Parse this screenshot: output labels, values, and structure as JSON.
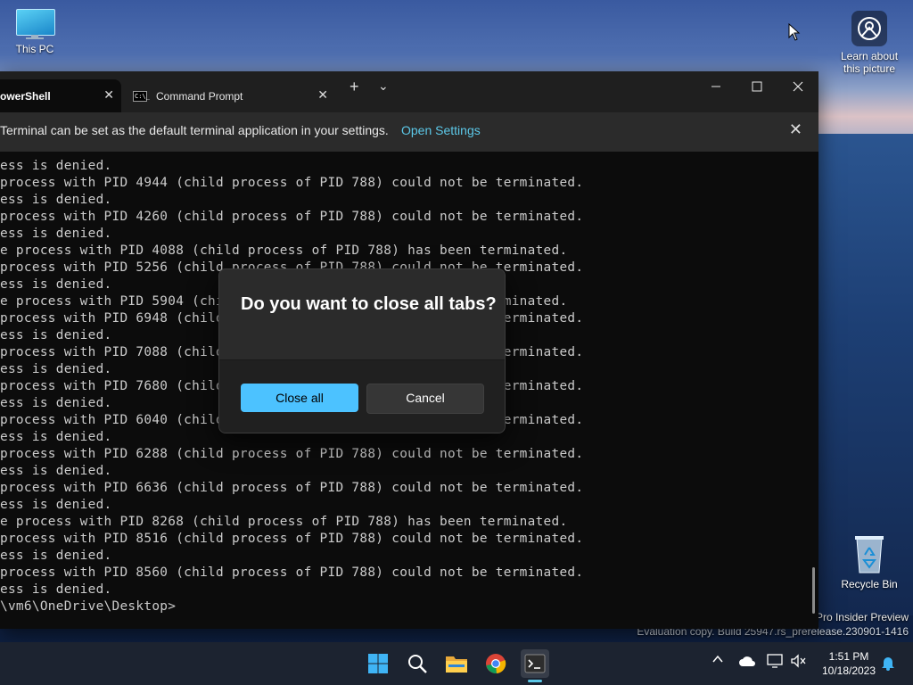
{
  "desktop": {
    "this_pc_label": "This PC",
    "learn_label_1": "Learn about",
    "learn_label_2": "this picture",
    "recycle_bin_label": "Recycle Bin",
    "watermark_line1": "Pro Insider Preview",
    "watermark_line2": "Evaluation copy. Build 25947.rs_prerelease.230901-1416"
  },
  "terminal": {
    "tabs": [
      {
        "label": "owerShell",
        "icon": "powershell-icon"
      },
      {
        "label": "Command Prompt",
        "icon": "cmd-icon"
      }
    ],
    "cmd_icon_text": "C:\\_",
    "new_tab_glyph": "+",
    "dropdown_glyph": "⌄",
    "infobar": {
      "message": "Terminal can be set as the default terminal application in your settings.",
      "link": "Open Settings"
    },
    "console_lines": [
      "ess is denied.",
      "process with PID 4944 (child process of PID 788) could not be terminated.",
      "ess is denied.",
      "process with PID 4260 (child process of PID 788) could not be terminated.",
      "ess is denied.",
      "e process with PID 4088 (child process of PID 788) has been terminated.",
      "process with PID 5256 (child process of PID 788) could not be terminated.",
      "ess is denied.",
      "e process with PID 5904 (child process of PID 788) has been terminated.",
      "process with PID 6948 (child process of PID 788) could not be terminated.",
      "ess is denied.",
      "process with PID 7088 (child process of PID 788) could not be terminated.",
      "ess is denied.",
      "process with PID 7680 (child process of PID 788) could not be terminated.",
      "ess is denied.",
      "process with PID 6040 (child process of PID 788) could not be terminated.",
      "ess is denied.",
      "process with PID 6288 (child process of PID 788) could not be terminated.",
      "ess is denied.",
      "process with PID 6636 (child process of PID 788) could not be terminated.",
      "ess is denied.",
      "e process with PID 8268 (child process of PID 788) has been terminated.",
      "process with PID 8516 (child process of PID 788) could not be terminated.",
      "ess is denied.",
      "process with PID 8560 (child process of PID 788) could not be terminated.",
      "ess is denied.",
      "\\vm6\\OneDrive\\Desktop>"
    ]
  },
  "dialog": {
    "title": "Do you want to close all tabs?",
    "primary_button": "Close all",
    "secondary_button": "Cancel"
  },
  "taskbar": {
    "time": "1:51 PM",
    "date": "10/18/2023",
    "icons": [
      "start-icon",
      "search-icon",
      "file-explorer-icon",
      "chrome-icon",
      "terminal-icon"
    ]
  },
  "colors": {
    "accent": "#4cc2ff",
    "link": "#5cc8e8"
  }
}
